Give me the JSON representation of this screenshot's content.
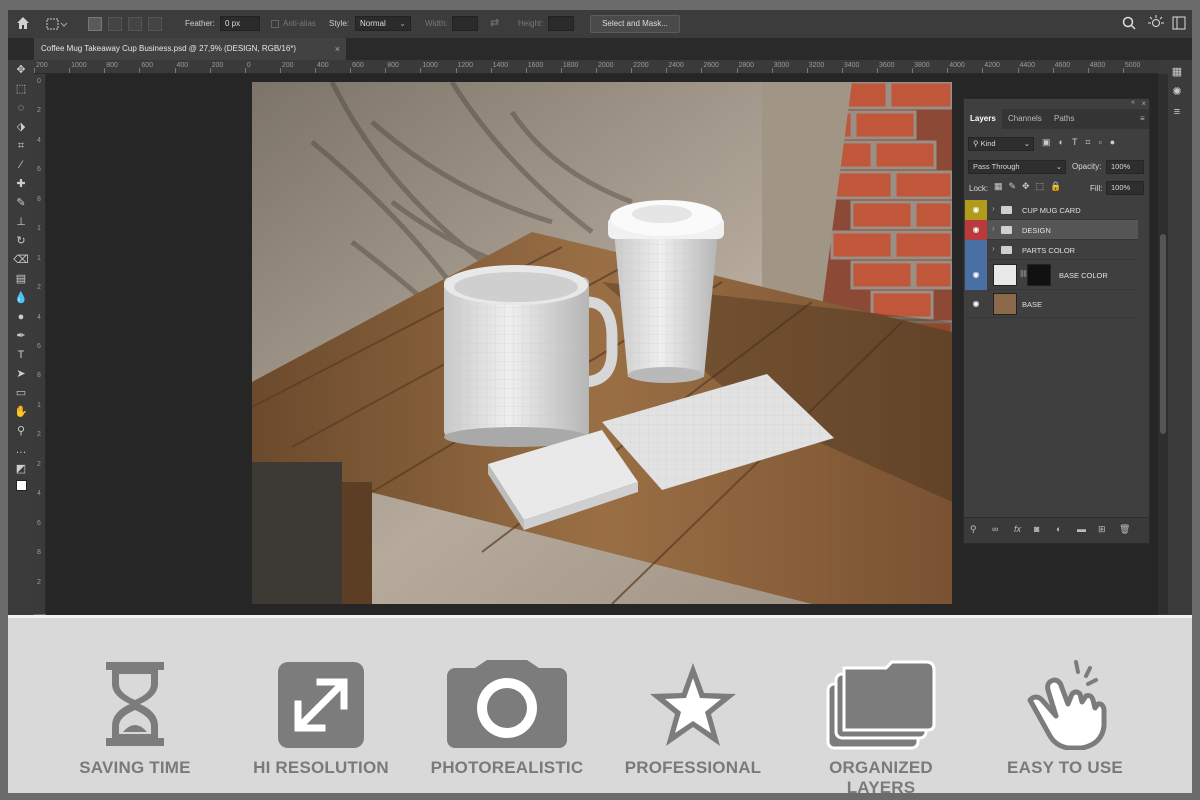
{
  "options_bar": {
    "feather_label": "Feather:",
    "feather_value": "0 px",
    "antialias_label": "Anti-alias",
    "style_label": "Style:",
    "style_value": "Normal",
    "width_label": "Width:",
    "height_label": "Height:",
    "mask_button": "Select and Mask..."
  },
  "document": {
    "tab_title": "Coffee Mug Takeaway Cup Business.psd @ 27,9% (DESIGN, RGB/16*)",
    "close_glyph": "×"
  },
  "ruler": {
    "h_labels": [
      "200",
      "1000",
      "800",
      "600",
      "400",
      "200",
      "0",
      "200",
      "400",
      "600",
      "800",
      "1000",
      "1200",
      "1400",
      "1600",
      "1800",
      "2000",
      "2200",
      "2400",
      "2600",
      "2800",
      "3000",
      "3200",
      "3400",
      "3600",
      "3800",
      "4000",
      "4200",
      "4400",
      "4600",
      "4800",
      "5000"
    ],
    "v_labels": [
      "0",
      "2",
      "4",
      "6",
      "8",
      "1",
      "1",
      "2",
      "4",
      "6",
      "8",
      "1",
      "2",
      "2",
      "4",
      "6",
      "8",
      "2"
    ]
  },
  "layers_panel": {
    "tabs": [
      "Layers",
      "Channels",
      "Paths"
    ],
    "kind_filter": "Kind",
    "blend_mode": "Pass Through",
    "opacity_label": "Opacity:",
    "opacity_value": "100%",
    "lock_label": "Lock:",
    "fill_label": "Fill:",
    "fill_value": "100%",
    "layers": [
      {
        "name": "CUP MUG CARD",
        "type": "group",
        "visible": true,
        "color": "#b29a1c"
      },
      {
        "name": "DESIGN",
        "type": "group",
        "visible": true,
        "color": "#b83a3a",
        "selected": true
      },
      {
        "name": "PARTS COLOR",
        "type": "group",
        "visible": false,
        "color": "#4a6fa5"
      },
      {
        "name": "BASE COLOR",
        "type": "adjustment",
        "visible": true,
        "color": "#4a6fa5"
      },
      {
        "name": "BASE",
        "type": "smart-object",
        "visible": true,
        "color": ""
      }
    ]
  },
  "features": [
    {
      "label": "SAVING TIME",
      "icon": "hourglass-icon"
    },
    {
      "label": "HI RESOLUTION",
      "icon": "expand-arrows-icon"
    },
    {
      "label": "PHOTOREALISTIC",
      "icon": "camera-icon"
    },
    {
      "label": "PROFESSIONAL",
      "icon": "star-icon"
    },
    {
      "label": "ORGANIZED LAYERS",
      "icon": "stacked-folders-icon"
    },
    {
      "label": "EASY TO USE",
      "icon": "hand-tap-icon"
    }
  ],
  "colors": {
    "feature_icon": "#7c7c7c",
    "feature_bg": "#d9d9d9",
    "ps_panel": "#3f3f3f"
  }
}
